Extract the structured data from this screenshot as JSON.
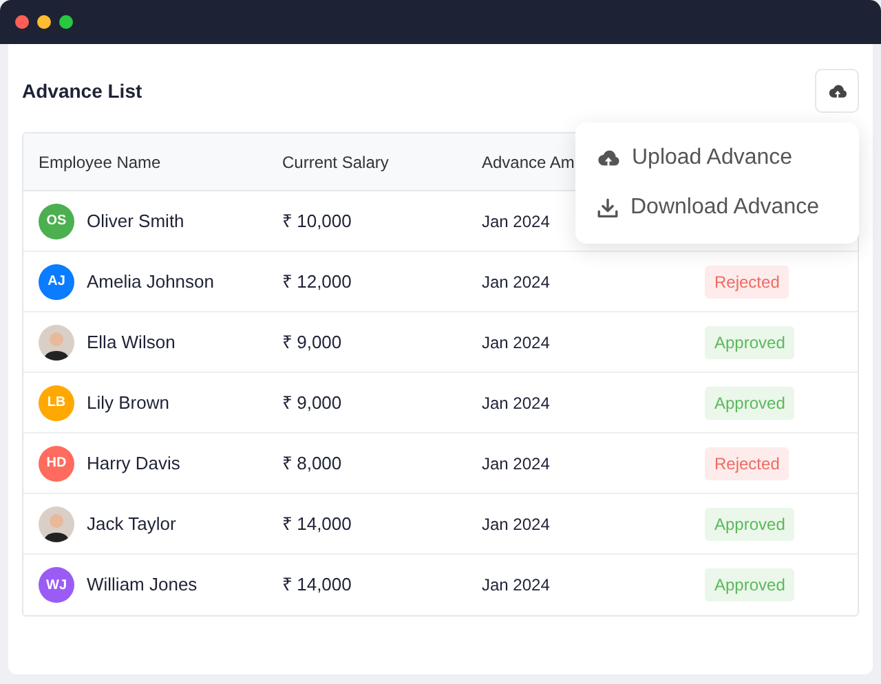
{
  "window": {
    "controls": [
      {
        "color": "#ff5f57"
      },
      {
        "color": "#febc2e"
      },
      {
        "color": "#28c840"
      }
    ]
  },
  "title": "Advance List",
  "menu": {
    "items": [
      {
        "kind": "upload",
        "label": "Upload Advance"
      },
      {
        "kind": "download",
        "label": "Download Advance"
      }
    ]
  },
  "table": {
    "columns": [
      "Employee Name",
      "Current Salary",
      "Advance Am"
    ],
    "rows": [
      {
        "avatar": {
          "kind": "initials",
          "initials": "OS",
          "color": "#4caf50"
        },
        "name": "Oliver Smith",
        "salary": "₹ 10,000",
        "month": "Jan 2024"
      },
      {
        "avatar": {
          "kind": "initials",
          "initials": "AJ",
          "color": "#0a7cff"
        },
        "name": "Amelia Johnson",
        "salary": "₹ 12,000",
        "month": "Jan 2024",
        "status": {
          "kind": "rejected",
          "label": "Rejected"
        }
      },
      {
        "avatar": {
          "kind": "photo"
        },
        "name": "Ella Wilson",
        "salary": "₹ 9,000",
        "month": "Jan 2024",
        "status": {
          "kind": "approved",
          "label": "Approved"
        }
      },
      {
        "avatar": {
          "kind": "initials",
          "initials": "LB",
          "color": "#ffa800"
        },
        "name": "Lily Brown",
        "salary": "₹ 9,000",
        "month": "Jan 2024",
        "status": {
          "kind": "approved",
          "label": "Approved"
        }
      },
      {
        "avatar": {
          "kind": "initials",
          "initials": "HD",
          "color": "#ff6b5e"
        },
        "name": "Harry Davis",
        "salary": "₹ 8,000",
        "month": "Jan 2024",
        "status": {
          "kind": "rejected",
          "label": "Rejected"
        }
      },
      {
        "avatar": {
          "kind": "photo"
        },
        "name": "Jack Taylor",
        "salary": "₹ 14,000",
        "month": "Jan 2024",
        "status": {
          "kind": "approved",
          "label": "Approved"
        }
      },
      {
        "avatar": {
          "kind": "initials",
          "initials": "WJ",
          "color": "#9b5cf6"
        },
        "name": "William Jones",
        "salary": "₹ 14,000",
        "month": "Jan 2024",
        "status": {
          "kind": "approved",
          "label": "Approved"
        }
      }
    ]
  }
}
